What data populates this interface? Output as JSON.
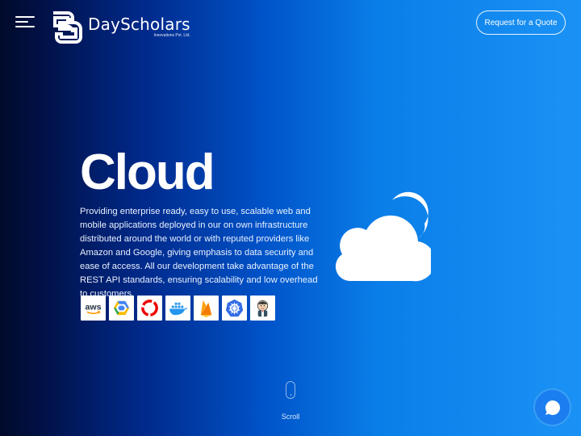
{
  "header": {
    "menu_icon": "hamburger-menu-icon",
    "logo": {
      "name": "DayScholars",
      "subtitle": "Innovations Pvt. Ltd."
    },
    "quote_button_label": "Request for a Quote"
  },
  "hero": {
    "title": "Cloud",
    "description": "Providing enterprise ready, easy to use, scalable web and mobile applications deployed in our on own infrastructure distributed around the world or with reputed providers like Amazon and Google, giving emphasis to data security and ease of access. All our development take advantage of the REST API standards, ensuring scalability and low overhead to customers.",
    "illustration_icon": "cloud-icon",
    "tech_logos": [
      {
        "name": "aws-logo",
        "label": "aws"
      },
      {
        "name": "google-cloud-logo",
        "label": ""
      },
      {
        "name": "openshift-logo",
        "label": ""
      },
      {
        "name": "docker-logo",
        "label": ""
      },
      {
        "name": "firebase-logo",
        "label": ""
      },
      {
        "name": "kubernetes-logo",
        "label": ""
      },
      {
        "name": "jenkins-logo",
        "label": ""
      }
    ]
  },
  "scroll": {
    "icon": "mouse-scroll-icon",
    "label": "Scroll"
  },
  "chat": {
    "icon": "chat-bubble-icon"
  },
  "colors": {
    "gradient_start": "#010a2a",
    "gradient_end": "#1a92f5",
    "text": "#ffffff"
  }
}
